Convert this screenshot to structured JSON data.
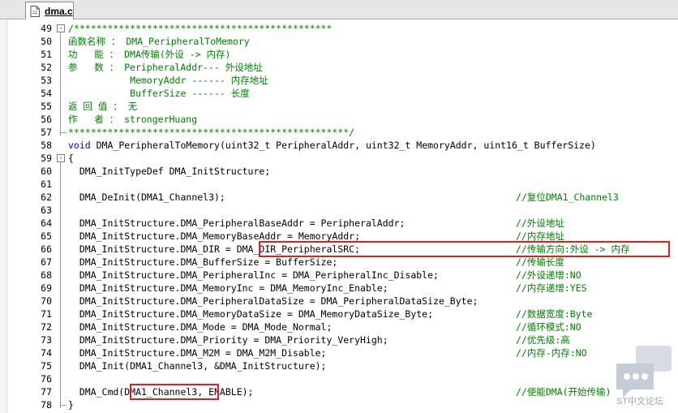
{
  "tab": {
    "label": "dma.c"
  },
  "lines": [
    {
      "n": "49",
      "fold": "-",
      "text": "/**********************************************",
      "color": "#008000"
    },
    {
      "n": "50",
      "text": "函数名称 ： DMA_PeripheralToMemory",
      "color": "#008000"
    },
    {
      "n": "51",
      "text": "功   能 ： DMA传输(外设 -> 内存)",
      "color": "#008000"
    },
    {
      "n": "52",
      "text": "参   数 ： PeripheralAddr--- 外设地址",
      "color": "#008000"
    },
    {
      "n": "53",
      "text": "           MemoryAddr ------ 内存地址",
      "color": "#008000"
    },
    {
      "n": "54",
      "text": "           BufferSize ------ 长度",
      "color": "#008000"
    },
    {
      "n": "55",
      "text": "返 回 值 ： 无",
      "color": "#008000"
    },
    {
      "n": "56",
      "text": "作   者 ： strongerHuang",
      "color": "#008000"
    },
    {
      "n": "57",
      "text": "**************************************************/",
      "color": "#008000"
    },
    {
      "n": "58",
      "kw": "void",
      "text": " DMA_PeripheralToMemory(uint32_t PeripheralAddr, uint32_t MemoryAddr, uint16_t BufferSize)",
      "color": "#000000"
    },
    {
      "n": "59",
      "fold": "-",
      "text": "{",
      "color": "#000000"
    },
    {
      "n": "60",
      "text": "  DMA_InitTypeDef DMA_InitStructure;",
      "color": "#000000"
    },
    {
      "n": "61",
      "text": "",
      "color": "#000000"
    },
    {
      "n": "62",
      "text": "  DMA_DeInit(DMA1_Channel3);",
      "comment": "//复位DMA1_Channel3",
      "color": "#000000"
    },
    {
      "n": "63",
      "text": "",
      "color": "#000000"
    },
    {
      "n": "64",
      "text": "  DMA_InitStructure.DMA_PeripheralBaseAddr = PeripheralAddr;",
      "comment": "//外设地址",
      "color": "#000000"
    },
    {
      "n": "65",
      "text": "  DMA_InitStructure.DMA_MemoryBaseAddr = MemoryAddr;",
      "comment": "//内存地址",
      "color": "#000000"
    },
    {
      "n": "66",
      "text": "  DMA_InitStructure.DMA_DIR = DMA_DIR_PeripheralSRC;",
      "comment": "//传输方向:外设 -> 内存",
      "color": "#000000"
    },
    {
      "n": "67",
      "text": "  DMA_InitStructure.DMA_BufferSize = BufferSize;",
      "comment": "//传输长度",
      "color": "#000000"
    },
    {
      "n": "68",
      "text": "  DMA_InitStructure.DMA_PeripheralInc = DMA_PeripheralInc_Disable;",
      "comment": "//外设递增:NO",
      "color": "#000000"
    },
    {
      "n": "69",
      "text": "  DMA_InitStructure.DMA_MemoryInc = DMA_MemoryInc_Enable;",
      "comment": "//内存递增:YES",
      "color": "#000000"
    },
    {
      "n": "70",
      "text": "  DMA_InitStructure.DMA_PeripheralDataSize = DMA_PeripheralDataSize_Byte;",
      "color": "#000000"
    },
    {
      "n": "71",
      "text": "  DMA_InitStructure.DMA_MemoryDataSize = DMA_MemoryDataSize_Byte;",
      "comment": "//数据宽度:Byte",
      "color": "#000000"
    },
    {
      "n": "72",
      "text": "  DMA_InitStructure.DMA_Mode = DMA_Mode_Normal;",
      "comment": "//循环模式:NO",
      "color": "#000000"
    },
    {
      "n": "73",
      "text": "  DMA_InitStructure.DMA_Priority = DMA_Priority_VeryHigh;",
      "comment": "//优先级:高",
      "color": "#000000"
    },
    {
      "n": "74",
      "text": "  DMA_InitStructure.DMA_M2M = DMA_M2M_Disable;",
      "comment": "//内存-内存:NO",
      "color": "#000000"
    },
    {
      "n": "75",
      "text": "  DMA_Init(DMA1_Channel3, &DMA_InitStructure);",
      "color": "#000000"
    },
    {
      "n": "76",
      "text": "",
      "color": "#000000"
    },
    {
      "n": "77",
      "text": "  DMA_Cmd(DMA1_Channel3, ENABLE);",
      "comment": "//使能DMA(开始传输)",
      "color": "#000000"
    },
    {
      "n": "78",
      "text": "}",
      "color": "#000000"
    }
  ],
  "watermark": {
    "label": "ST中文论坛"
  },
  "colors": {
    "comment": "#008000",
    "keyword": "#0000ff",
    "highlight": "#e02020"
  }
}
